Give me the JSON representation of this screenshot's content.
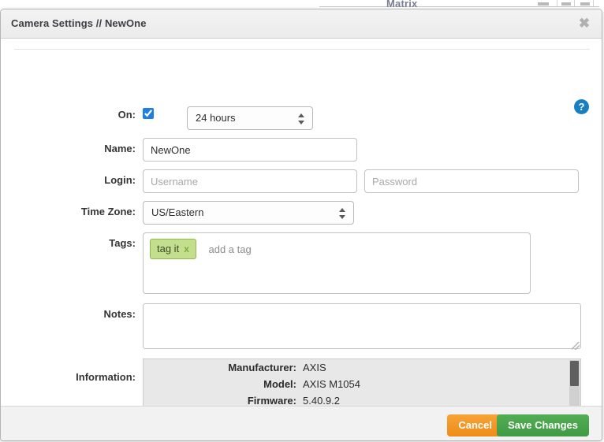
{
  "background": {
    "partial_title": "Matrix"
  },
  "modal": {
    "title": "Camera Settings // NewOne",
    "close_label": "✖",
    "help_label": "?",
    "form": {
      "on": {
        "label": "On:",
        "checked": true,
        "duration_value": "24 hours"
      },
      "name": {
        "label": "Name:",
        "value": "NewOne"
      },
      "login": {
        "label": "Login:",
        "username_placeholder": "Username",
        "password_placeholder": "Password"
      },
      "timezone": {
        "label": "Time Zone:",
        "value": "US/Eastern"
      },
      "tags": {
        "label": "Tags:",
        "chips": [
          {
            "text": "tag it",
            "remove_label": "x"
          }
        ],
        "add_placeholder": "add a tag"
      },
      "notes": {
        "label": "Notes:",
        "value": "",
        "placeholder": ""
      },
      "information": {
        "label": "Information:",
        "rows": [
          {
            "key": "Manufacturer:",
            "value": "AXIS"
          },
          {
            "key": "Model:",
            "value": "AXIS M1054"
          },
          {
            "key": "Firmware:",
            "value": "5.40.9.2"
          }
        ]
      }
    },
    "footer": {
      "cancel_label": "Cancel",
      "save_label": "Save Changes"
    }
  },
  "colors": {
    "accent_blue": "#1a7fc1",
    "checkbox_blue": "#1f7ee6",
    "tag_green_bg": "#c3de8c",
    "tag_green_border": "#8ebc4f",
    "cancel_orange": "#ef8c18",
    "save_green": "#3f9a44",
    "info_panel_bg": "#e8e8e8"
  }
}
